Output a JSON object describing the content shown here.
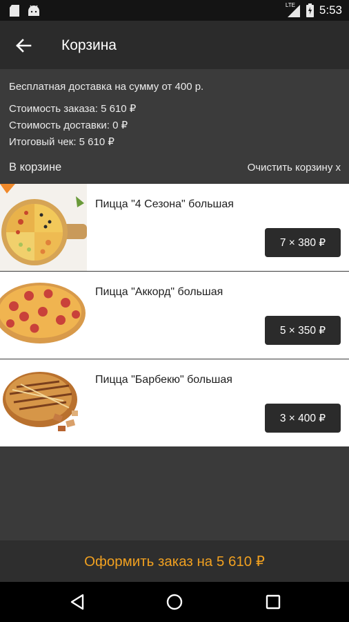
{
  "status_bar": {
    "time": "5:53",
    "network": "LTE",
    "icons": [
      "sd-card-icon",
      "android-icon",
      "lte-signal-icon",
      "battery-icon"
    ]
  },
  "app_bar": {
    "back_icon": "arrow-back-icon",
    "title": "Корзина"
  },
  "summary": {
    "free_delivery": "Бесплатная доставка на сумму от 400 р.",
    "order_cost": "Стоимость заказа: 5 610 ₽",
    "delivery_cost": "Стоимость доставки: 0 ₽",
    "total": "Итоговый чек: 5 610 ₽"
  },
  "cart": {
    "header": "В корзине",
    "clear_label": "Очистить корзину x",
    "items": [
      {
        "title": "Пицца \"4 Сезона\" большая",
        "qty_price": "7 × 380 ₽"
      },
      {
        "title": "Пицца \"Аккорд\" большая",
        "qty_price": "5 × 350 ₽"
      },
      {
        "title": "Пицца \"Барбекю\" большая",
        "qty_price": "3 × 400 ₽"
      }
    ]
  },
  "checkout": {
    "label": "Оформить заказ на 5 610 ₽"
  },
  "colors": {
    "accent": "#f0a020",
    "app_bar": "#2b2b2b",
    "background": "#3a3a3a"
  },
  "nav_bar": {
    "icons": [
      "back-triangle-icon",
      "home-circle-icon",
      "recents-square-icon"
    ]
  }
}
